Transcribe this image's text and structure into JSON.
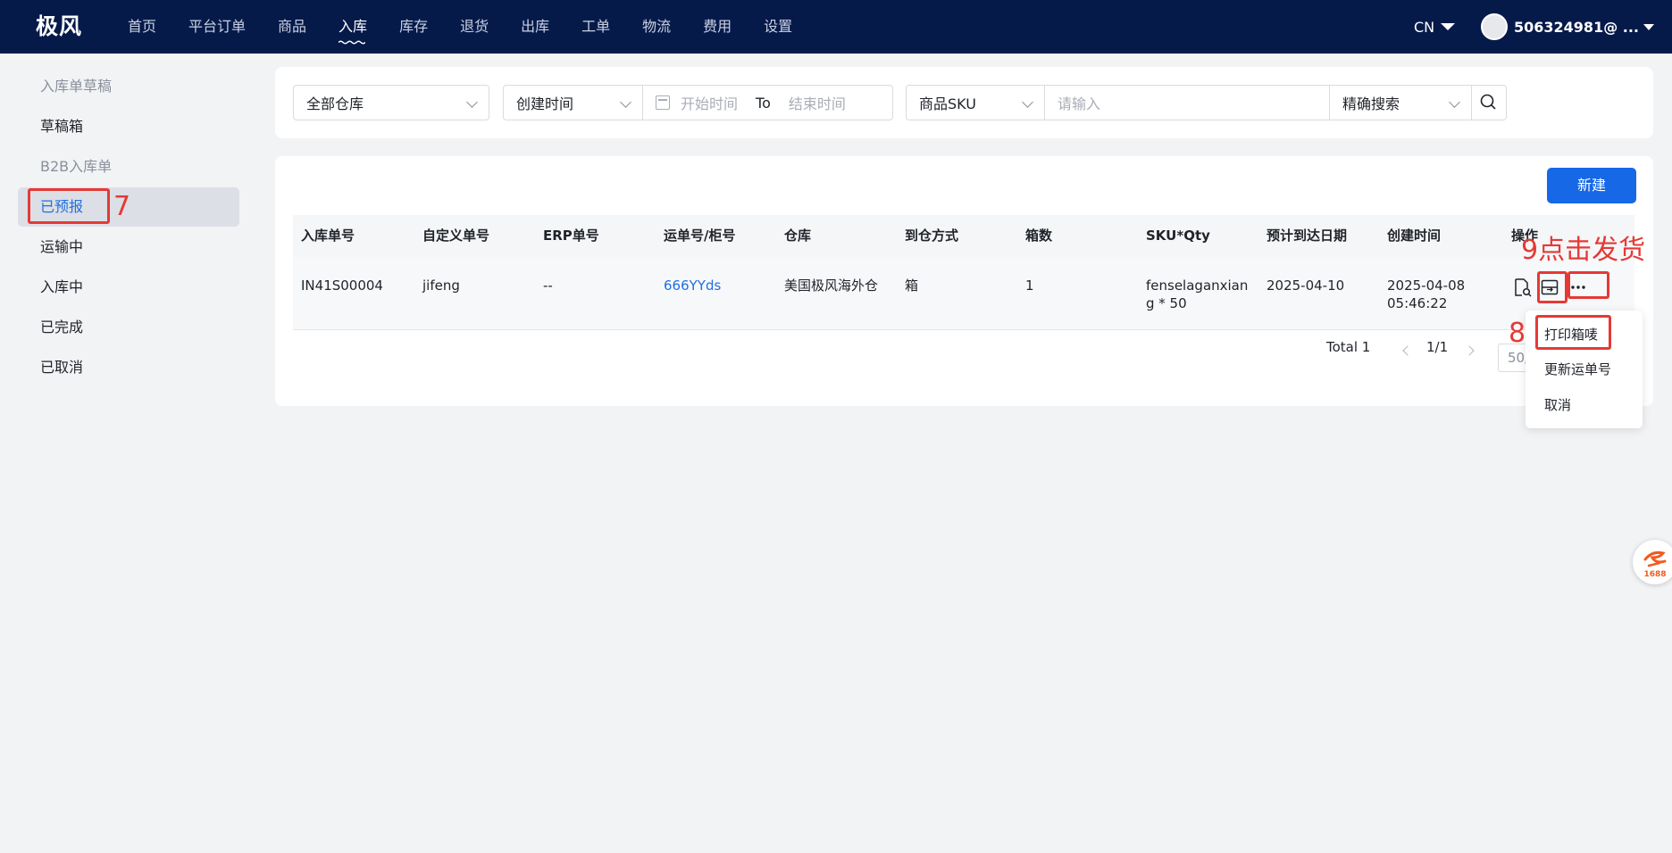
{
  "app": {
    "logo": "极风",
    "nav": [
      "首页",
      "平台订单",
      "商品",
      "入库",
      "库存",
      "退货",
      "出库",
      "工单",
      "物流",
      "费用",
      "设置"
    ],
    "nav_active": "入库",
    "lang": "CN",
    "user": "506324981@ ..."
  },
  "sidebar": {
    "items": [
      {
        "label": "入库单草稿",
        "type": "group"
      },
      {
        "label": "草稿箱",
        "type": "item"
      },
      {
        "label": "B2B入库单",
        "type": "group"
      },
      {
        "label": "已预报",
        "type": "active"
      },
      {
        "label": "运输中",
        "type": "item"
      },
      {
        "label": "入库中",
        "type": "item"
      },
      {
        "label": "已完成",
        "type": "item"
      },
      {
        "label": "已取消",
        "type": "item"
      }
    ]
  },
  "filters": {
    "warehouse": "全部仓库",
    "time_type": "创建时间",
    "start_placeholder": "开始时间",
    "to": "To",
    "end_placeholder": "结束时间",
    "field": "商品SKU",
    "input_placeholder": "请输入",
    "match": "精确搜索"
  },
  "table": {
    "new_button": "新建",
    "headers": [
      "入库单号",
      "自定义单号",
      "ERP单号",
      "运单号/柜号",
      "仓库",
      "到仓方式",
      "箱数",
      "SKU*Qty",
      "预计到达日期",
      "创建时间",
      "操作"
    ],
    "row": {
      "order_no": "IN41S00004",
      "custom_no": "jifeng",
      "erp_no": "--",
      "tracking_no": "666YYds",
      "warehouse": "美国极风海外仓",
      "arrival_mode": "箱",
      "boxes": "1",
      "sku_line1": "fenselaganxian",
      "sku_line2": "g * 50",
      "eta": "2025-04-10",
      "created_date": "2025-04-08",
      "created_time": "05:46:22"
    },
    "pager": {
      "total": "Total 1",
      "page": "1/1",
      "size": "50/"
    }
  },
  "menu": [
    "打印箱唛",
    "更新运单号",
    "取消"
  ],
  "annotations": {
    "a7": "7",
    "a8": "8",
    "a9": "9点击发货"
  },
  "icons": {
    "view": "document-search-icon",
    "ship": "ship-box-icon",
    "more": "more-dots-icon",
    "floating": "1688-logo-icon"
  },
  "badge_text": "1688",
  "colors": {
    "nav_bg": "#061a4a",
    "primary": "#1668e6",
    "link": "#1f6fe0",
    "annotation": "#e53935"
  }
}
